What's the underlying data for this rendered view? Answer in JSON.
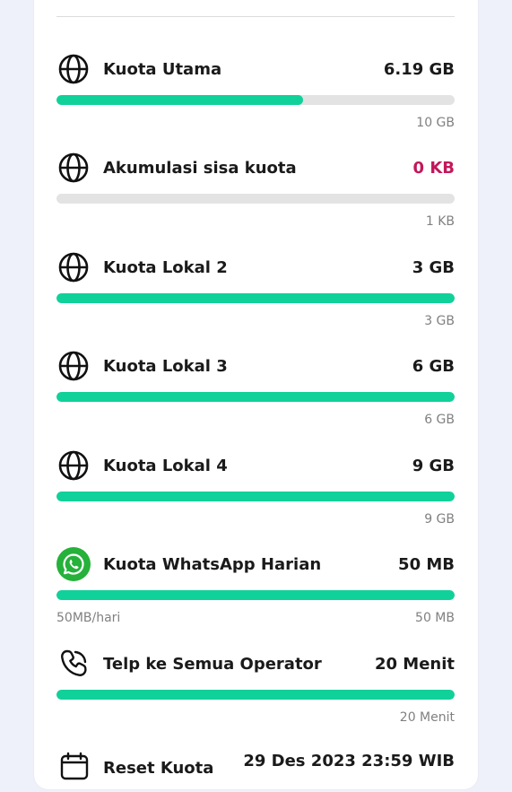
{
  "quota_items": [
    {
      "label": "Kuota Utama",
      "value": "6.19 GB",
      "total": "10 GB",
      "sub_left": "",
      "progress": 0.619,
      "icon": "globe-icon"
    },
    {
      "label": "Akumulasi sisa kuota",
      "value": "0 KB",
      "total": "1 KB",
      "sub_left": "",
      "progress": 0,
      "icon": "globe-icon",
      "value_color": "#c2185b"
    },
    {
      "label": "Kuota Lokal 2",
      "value": "3 GB",
      "total": "3 GB",
      "sub_left": "",
      "progress": 1,
      "icon": "globe-icon"
    },
    {
      "label": "Kuota Lokal 3",
      "value": "6 GB",
      "total": "6 GB",
      "sub_left": "",
      "progress": 1,
      "icon": "globe-icon"
    },
    {
      "label": "Kuota Lokal 4",
      "value": "9 GB",
      "total": "9 GB",
      "sub_left": "",
      "progress": 1,
      "icon": "globe-icon"
    },
    {
      "label": "Kuota WhatsApp Harian",
      "value": "50 MB",
      "total": "50 MB",
      "sub_left": "50MB/hari",
      "progress": 1,
      "icon": "whatsapp-icon"
    },
    {
      "label": "Telp ke Semua Operator",
      "value": "20 Menit",
      "total": "20 Menit",
      "sub_left": "",
      "progress": 1,
      "icon": "phone-icon"
    }
  ],
  "reset": {
    "label": "Reset Kuota",
    "value": "29 Des 2023 23:59 WIB",
    "icon": "calendar-icon"
  },
  "colors": {
    "progress_fill": "#10d19a",
    "progress_track": "#e3e3e3",
    "alert_value": "#c2185b",
    "whatsapp_green": "#25b13a",
    "background": "#eef0fa"
  }
}
